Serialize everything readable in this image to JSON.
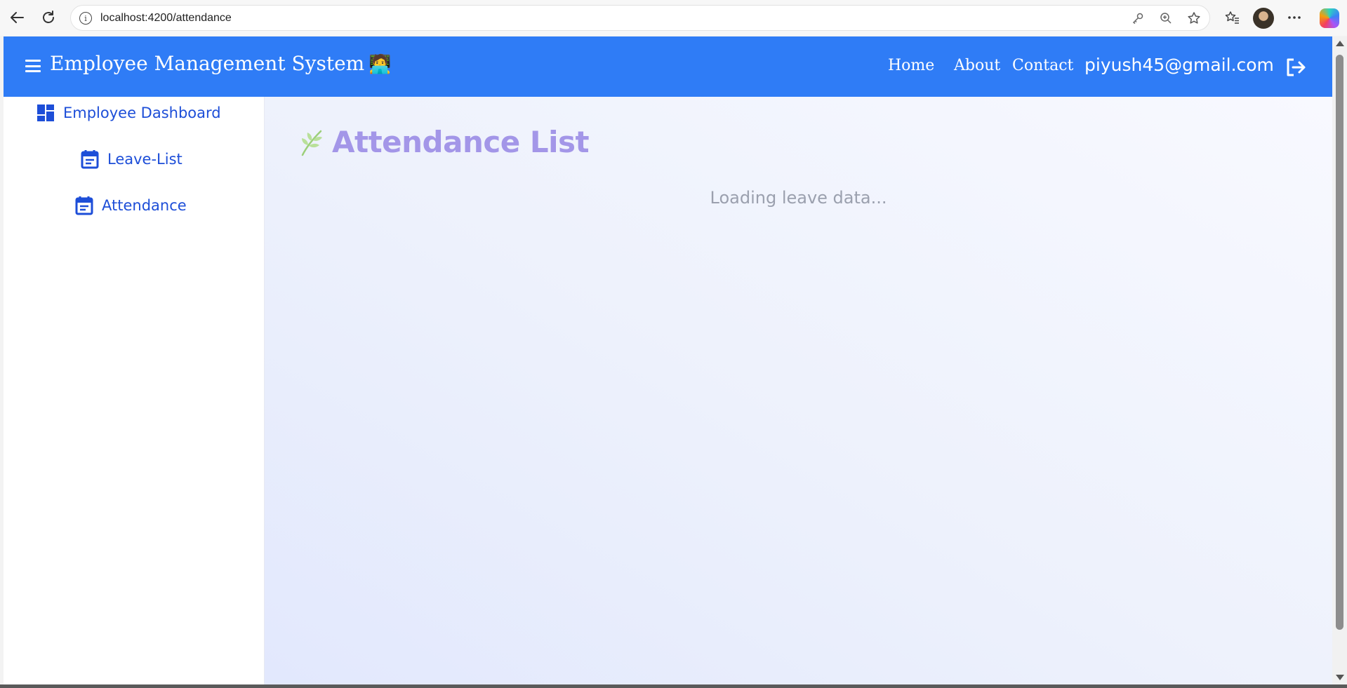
{
  "browser": {
    "url": "localhost:4200/attendance",
    "icons": {
      "back": "back-arrow-icon",
      "reload": "reload-icon",
      "site_info": "info-icon",
      "password": "key-icon",
      "zoom": "zoom-icon",
      "favorite": "star-icon",
      "favorites_list": "favorites-icon",
      "more": "more-icon",
      "copilot": "copilot-icon"
    }
  },
  "header": {
    "brand": "Employee Management System",
    "brand_emoji": "🧑‍💻",
    "nav": {
      "home": "Home",
      "about": "About",
      "contact": "Contact"
    },
    "user_email": "piyush45@gmail.com",
    "icons": {
      "menu": "hamburger-icon",
      "logout": "logout-icon"
    }
  },
  "sidebar": {
    "items": [
      {
        "label": "Employee Dashboard",
        "icon": "dashboard-icon"
      },
      {
        "label": "Leave-List",
        "icon": "calendar-icon"
      },
      {
        "label": "Attendance",
        "icon": "calendar-icon"
      }
    ]
  },
  "main": {
    "title": "Attendance List",
    "title_icon": "leaf-icon",
    "loading_text": "Loading leave data..."
  },
  "colors": {
    "header_bg": "#2f7cf6",
    "sidebar_text": "#1d4ed8",
    "title_color": "#a396e8",
    "loading_color": "#9ba0ae"
  }
}
